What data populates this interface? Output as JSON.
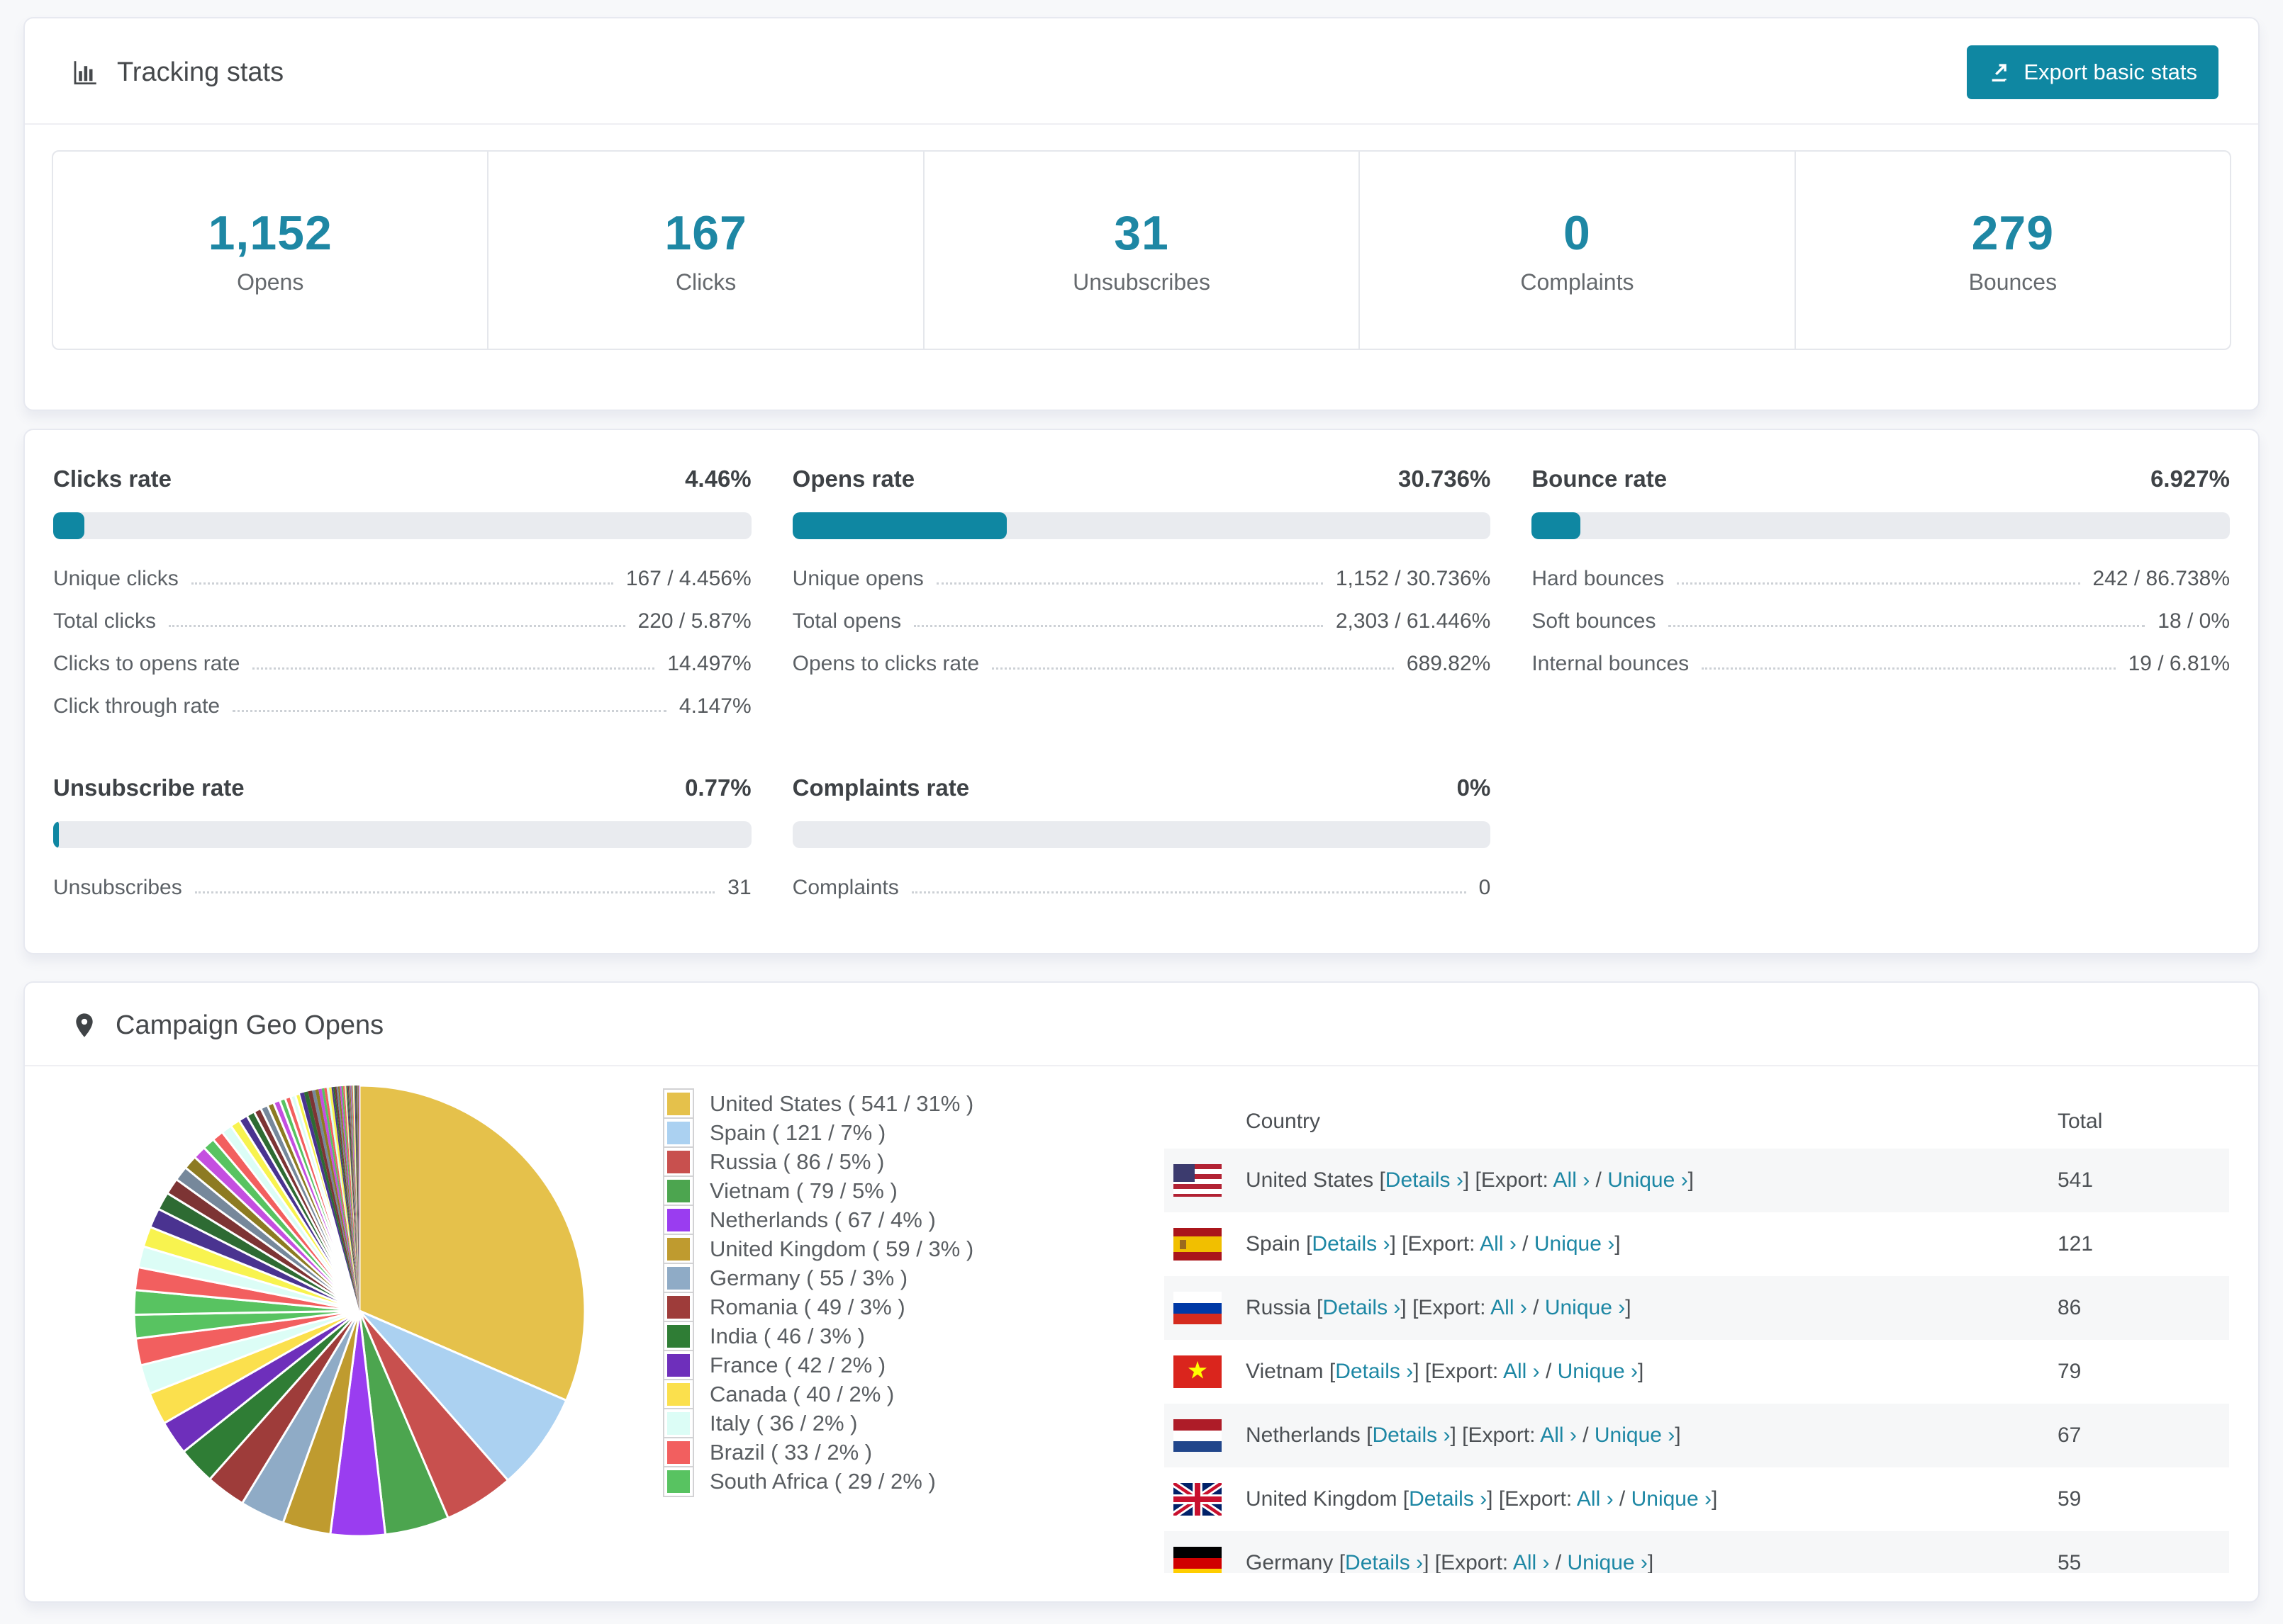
{
  "theme": {
    "accent": "#0f87a2",
    "stat_number_color": "#1e87a4",
    "link_color": "#1d87a4",
    "bar_track_color": "#e9ebef"
  },
  "tracking": {
    "title": "Tracking stats",
    "export_button": "Export basic stats",
    "stats": [
      {
        "value": "1,152",
        "label": "Opens"
      },
      {
        "value": "167",
        "label": "Clicks"
      },
      {
        "value": "31",
        "label": "Unsubscribes"
      },
      {
        "value": "0",
        "label": "Complaints"
      },
      {
        "value": "279",
        "label": "Bounces"
      }
    ]
  },
  "rates": [
    {
      "title": "Clicks rate",
      "value": "4.46%",
      "bar_pct": 4.46,
      "rows": [
        {
          "label": "Unique clicks",
          "value": "167 / 4.456%"
        },
        {
          "label": "Total clicks",
          "value": "220 / 5.87%"
        },
        {
          "label": "Clicks to opens rate",
          "value": "14.497%"
        },
        {
          "label": "Click through rate",
          "value": "4.147%"
        }
      ]
    },
    {
      "title": "Opens rate",
      "value": "30.736%",
      "bar_pct": 30.736,
      "rows": [
        {
          "label": "Unique opens",
          "value": "1,152 / 30.736%"
        },
        {
          "label": "Total opens",
          "value": "2,303 / 61.446%"
        },
        {
          "label": "Opens to clicks rate",
          "value": "689.82%"
        }
      ]
    },
    {
      "title": "Bounce rate",
      "value": "6.927%",
      "bar_pct": 6.927,
      "rows": [
        {
          "label": "Hard bounces",
          "value": "242 / 86.738%"
        },
        {
          "label": "Soft bounces",
          "value": "18 / 0%"
        },
        {
          "label": "Internal bounces",
          "value": "19 / 6.81%"
        }
      ]
    },
    {
      "title": "Unsubscribe rate",
      "value": "0.77%",
      "bar_pct": 0.77,
      "rows": [
        {
          "label": "Unsubscribes",
          "value": "31"
        }
      ]
    },
    {
      "title": "Complaints rate",
      "value": "0%",
      "bar_pct": 0,
      "rows": [
        {
          "label": "Complaints",
          "value": "0"
        }
      ]
    }
  ],
  "geo": {
    "title": "Campaign Geo Opens",
    "table": {
      "country_header": "Country",
      "total_header": "Total",
      "details_label": "Details",
      "export_label": "Export:",
      "all_label": "All",
      "unique_label": "Unique",
      "chevron": "›",
      "lbr": "[",
      "rbr": "]",
      "slash": "/",
      "rows": [
        {
          "flag": "us",
          "country": "United States",
          "total": "541"
        },
        {
          "flag": "es",
          "country": "Spain",
          "total": "121"
        },
        {
          "flag": "ru",
          "country": "Russia",
          "total": "86"
        },
        {
          "flag": "vn",
          "country": "Vietnam",
          "total": "79"
        },
        {
          "flag": "nl",
          "country": "Netherlands",
          "total": "67"
        },
        {
          "flag": "gb",
          "country": "United Kingdom",
          "total": "59"
        },
        {
          "flag": "de",
          "country": "Germany",
          "total": "55"
        }
      ]
    }
  },
  "chart_data": {
    "type": "pie",
    "title": "Campaign Geo Opens",
    "legend_position": "right",
    "start_angle_deg": -90,
    "series": [
      {
        "label": "United States",
        "value": 541,
        "pct": "31%",
        "color": "#e5c14b"
      },
      {
        "label": "Spain",
        "value": 121,
        "pct": "7%",
        "color": "#abd1f1"
      },
      {
        "label": "Russia",
        "value": 86,
        "pct": "5%",
        "color": "#c8504e"
      },
      {
        "label": "Vietnam",
        "value": 79,
        "pct": "5%",
        "color": "#4ca54f"
      },
      {
        "label": "Netherlands",
        "value": 67,
        "pct": "4%",
        "color": "#9a3df0"
      },
      {
        "label": "United Kingdom",
        "value": 59,
        "pct": "3%",
        "color": "#bf9b2f"
      },
      {
        "label": "Germany",
        "value": 55,
        "pct": "3%",
        "color": "#8fabc6"
      },
      {
        "label": "Romania",
        "value": 49,
        "pct": "3%",
        "color": "#9e3c3a"
      },
      {
        "label": "India",
        "value": 46,
        "pct": "3%",
        "color": "#2f7d35"
      },
      {
        "label": "France",
        "value": 42,
        "pct": "2%",
        "color": "#6e2fbb"
      },
      {
        "label": "Canada",
        "value": 40,
        "pct": "2%",
        "color": "#fbe04d"
      },
      {
        "label": "Italy",
        "value": 36,
        "pct": "2%",
        "color": "#dcfdf6"
      },
      {
        "label": "Brazil",
        "value": 33,
        "pct": "2%",
        "color": "#f25f5f"
      },
      {
        "label": "South Africa",
        "value": 29,
        "pct": "2%",
        "color": "#58c361"
      }
    ],
    "others": {
      "palette": [
        "#58c361",
        "#f25f5f",
        "#dcfdf6",
        "#f8f34f",
        "#4a3390",
        "#2e6b33",
        "#7d3434",
        "#76889b",
        "#8d7b22",
        "#c44fe0"
      ],
      "values": [
        30,
        28,
        26,
        25,
        24,
        22,
        20,
        18,
        17,
        16,
        15,
        14,
        13,
        12,
        11,
        10,
        9,
        9,
        8,
        8,
        7,
        7,
        6,
        6,
        5,
        5,
        5,
        4,
        4,
        4,
        3,
        3,
        3,
        3,
        2,
        2,
        2,
        2,
        2,
        2,
        2,
        2,
        1,
        1,
        1,
        1,
        1,
        1,
        1,
        1,
        1,
        1,
        1,
        1,
        1,
        1,
        1,
        1,
        1,
        1
      ]
    }
  }
}
